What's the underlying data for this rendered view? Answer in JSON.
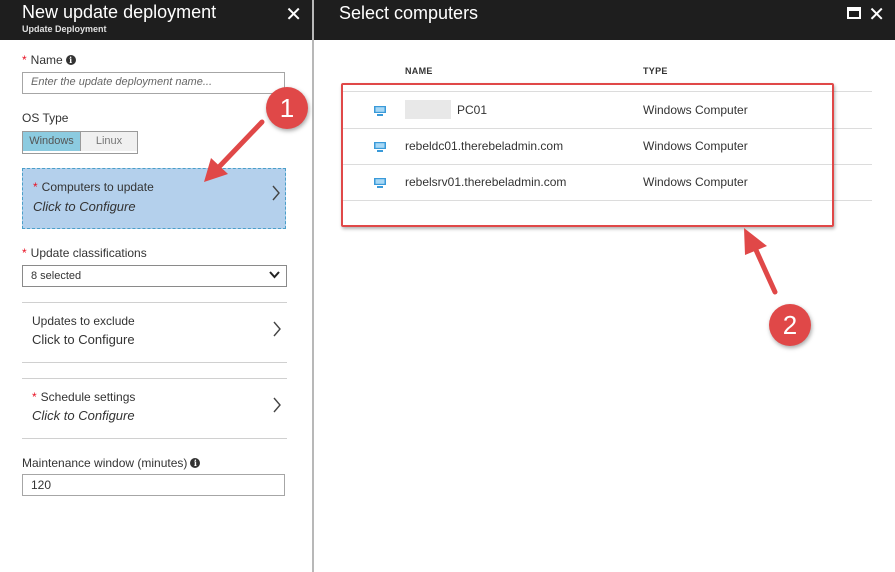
{
  "left_blade": {
    "title": "New update deployment",
    "subtitle": "Update Deployment",
    "name_label": "Name",
    "name_placeholder": "Enter the update deployment name...",
    "os_type_label": "OS Type",
    "os_options": [
      "Windows",
      "Linux"
    ],
    "os_selected": "Windows",
    "computers": {
      "title": "Computers to update",
      "value": "Click to Configure"
    },
    "classifications": {
      "label": "Update classifications",
      "value": "8 selected"
    },
    "exclude": {
      "title": "Updates to exclude",
      "value": "Click to Configure"
    },
    "schedule": {
      "title": "Schedule settings",
      "value": "Click to Configure"
    },
    "maintenance": {
      "label": "Maintenance window (minutes)",
      "value": "120"
    }
  },
  "right_blade": {
    "title": "Select computers",
    "columns": [
      "NAME",
      "TYPE"
    ],
    "rows": [
      {
        "name": "PC01",
        "type": "Windows Computer"
      },
      {
        "name": "rebeldc01.therebeladmin.com",
        "type": "Windows Computer"
      },
      {
        "name": "rebelsrv01.therebeladmin.com",
        "type": "Windows Computer"
      }
    ]
  },
  "annotations": {
    "badge1": "1",
    "badge2": "2",
    "color": "#e04848"
  },
  "colors": {
    "header": "#1e1e1e",
    "selected_section": "#b4d0ec",
    "toggle_active": "#8ccbe0",
    "required_star": "#e81123"
  }
}
